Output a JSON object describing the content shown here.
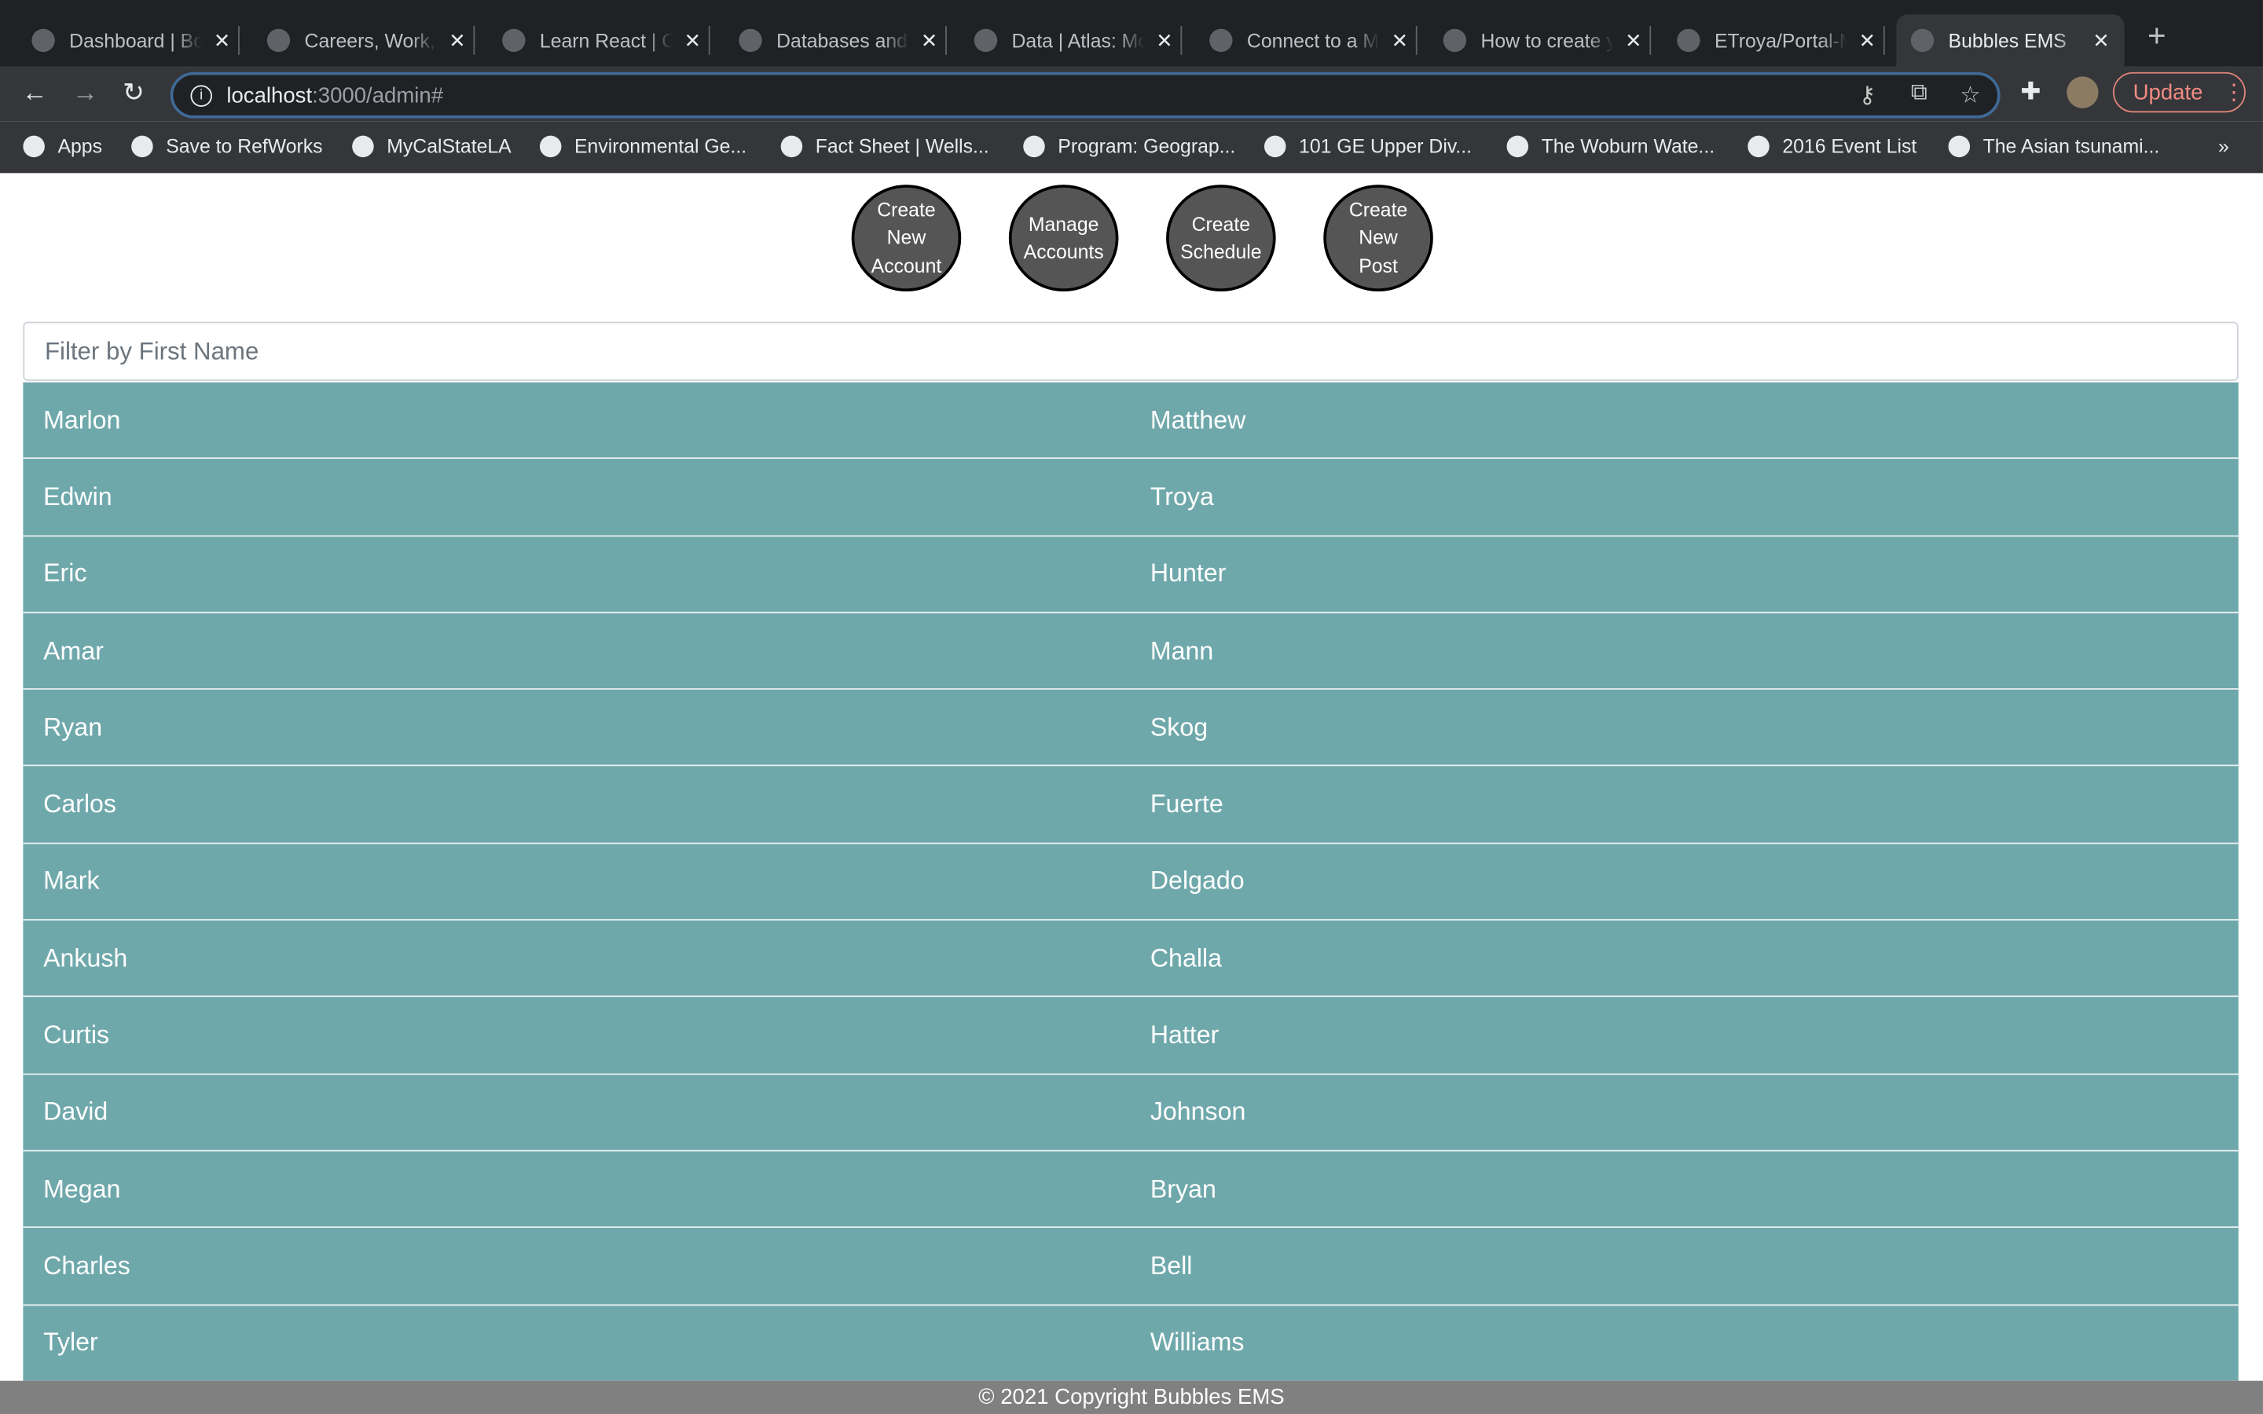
{
  "browser": {
    "tabs": [
      {
        "title": "Dashboard | Bo",
        "icon": "globe-icon"
      },
      {
        "title": "Careers, Work,",
        "icon": "handshake-icon"
      },
      {
        "title": "Learn React | C",
        "icon": "codecademy-icon"
      },
      {
        "title": "Databases and",
        "icon": "mongodb-leaf-icon"
      },
      {
        "title": "Data | Atlas: Mo",
        "icon": "mongodb-leaf-icon"
      },
      {
        "title": "Connect to a M",
        "icon": "mongodb-leaf-icon"
      },
      {
        "title": "How to create y",
        "icon": "freecodecamp-icon"
      },
      {
        "title": "ETroya/Portal-M",
        "icon": "github-icon"
      },
      {
        "title": "Bubbles EMS",
        "icon": "globe-icon",
        "active": true
      }
    ],
    "url_host": "localhost",
    "url_path": ":3000/admin#",
    "update_label": "Update",
    "bookmarks": [
      "Apps",
      "Save to RefWorks",
      "MyCalStateLA",
      "Environmental Ge...",
      "Fact Sheet | Wells...",
      "Program: Geograp...",
      "101 GE Upper Div...",
      "The Woburn Wate...",
      "2016 Event List",
      "The Asian tsunami..."
    ],
    "more_bookmarks": "»"
  },
  "page": {
    "actions": [
      {
        "label": "Create\nNew\nAccount"
      },
      {
        "label": "Manage\nAccounts"
      },
      {
        "label": "Create\nSchedule"
      },
      {
        "label": "Create\nNew\nPost"
      }
    ],
    "filter_placeholder": "Filter by First Name",
    "filter_value": "",
    "row_color": "#6fa8ab",
    "users": [
      [
        "Marlon",
        "Matthew"
      ],
      [
        "Edwin",
        "Troya"
      ],
      [
        "Eric",
        "Hunter"
      ],
      [
        "Amar",
        "Mann"
      ],
      [
        "Ryan",
        "Skog"
      ],
      [
        "Carlos",
        "Fuerte"
      ],
      [
        "Mark",
        "Delgado"
      ],
      [
        "Ankush",
        "Challa"
      ],
      [
        "Curtis",
        "Hatter"
      ],
      [
        "David",
        "Johnson"
      ],
      [
        "Megan",
        "Bryan"
      ],
      [
        "Charles",
        "Bell"
      ],
      [
        "Tyler",
        "Williams"
      ]
    ],
    "footer": "© 2021 Copyright Bubbles EMS"
  }
}
